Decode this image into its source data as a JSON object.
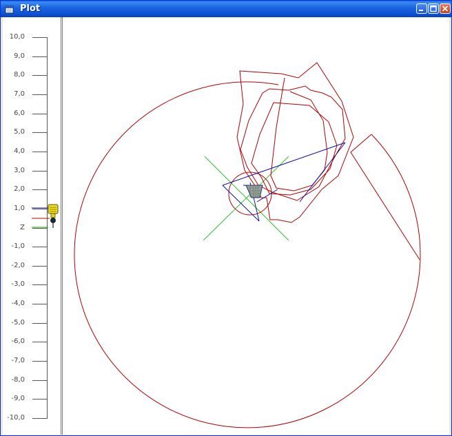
{
  "window": {
    "title": "Plot",
    "icon": "plot-window-icon",
    "buttons": [
      "minimize-icon",
      "maximize-icon",
      "close-icon"
    ]
  },
  "ruler": {
    "ticks": [
      "10,0",
      "9,0",
      "8,0",
      "7,0",
      "6,0",
      "5,0",
      "4,0",
      "3,0",
      "2,0",
      "1,0",
      "Z",
      "-1,0",
      "-2,0",
      "-3,0",
      "-4,0",
      "-5,0",
      "-6,0",
      "-7,0",
      "-8,0",
      "-9,0",
      "-10,0"
    ],
    "tool_icon": "cutting-tool-icon",
    "indicator_colors": {
      "blue": "#0000c0",
      "red": "#c00000",
      "green": "#00b000"
    }
  },
  "plot": {
    "toolpath_color": "#b00000",
    "rapid_color": "#1010a0",
    "crosshair_color": "#30c030",
    "marker_icon": "workpiece-origin-icon"
  }
}
